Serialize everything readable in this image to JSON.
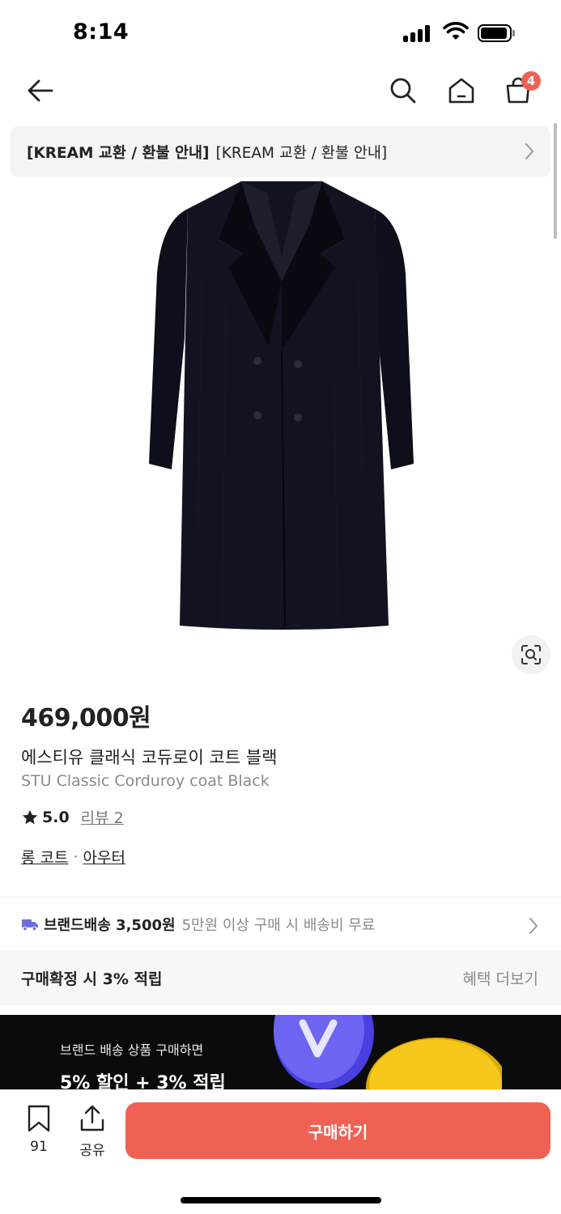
{
  "status_bar": {
    "time": "8:14"
  },
  "nav": {
    "cart_count": "4"
  },
  "notice": {
    "bold_text": "[KREAM 교환 / 환불 안내]",
    "text": "[KREAM 교환 / 환불 안내]"
  },
  "product": {
    "price": "469,000원",
    "name_ko": "에스티유 클래식 코듀로이 코트 블랙",
    "name_en": "STU Classic Corduroy coat Black",
    "rating": "5.0",
    "review_link": "리뷰 2",
    "category_1": "롱 코트",
    "category_2": "아우터"
  },
  "shipping": {
    "label": "브랜드배송 3,500원",
    "description": "5만원 이상 구매 시 배송비 무료"
  },
  "benefit": {
    "label": "구매확정 시 3% 적립",
    "more": "혜택 더보기"
  },
  "promo": {
    "line1": "브랜드 배송 상품 구매하면",
    "line2": "5% 할인 + 3% 적립"
  },
  "bottom_bar": {
    "bookmark_count": "91",
    "share_label": "공유",
    "buy_label": "구매하기"
  },
  "colors": {
    "accent": "#ef6253",
    "promo_bg": "#0b0b0b"
  }
}
